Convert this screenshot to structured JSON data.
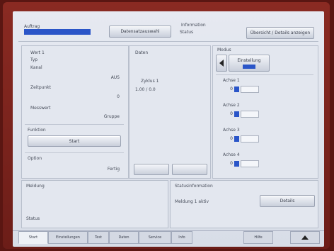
{
  "header": {
    "left_label": "Auftrag",
    "left_field_value": "",
    "main_button": "Datensatzauswahl",
    "right_label": "Information",
    "right_value": "Status",
    "right_button": "Übersicht / Details anzeigen"
  },
  "left_panel": {
    "rows": [
      {
        "label": "Wert 1",
        "value": ""
      },
      {
        "label": "Typ",
        "value": ""
      },
      {
        "label": "Kanal",
        "value": ""
      },
      {
        "label": "",
        "value": "AUS"
      },
      {
        "label": "Zeitpunkt",
        "value": ""
      },
      {
        "label": "",
        "value": "0"
      },
      {
        "label": "Messwert",
        "value": ""
      },
      {
        "label": "",
        "value": "Gruppe"
      }
    ],
    "section_label": "Funktion",
    "main_button": "Start",
    "bottom_label": "Option",
    "bottom_value": "Fertig"
  },
  "center_panel": {
    "title": "Daten",
    "line1": "Zyklus 1",
    "line2": "1.00 / 0.0",
    "btn_left": "",
    "btn_right": ""
  },
  "right_panel": {
    "top_label": "Modus",
    "top_sub_label": "Einstellung",
    "arrow_icon": "left-arrow-icon",
    "groups": [
      {
        "label": "Achse 1",
        "value": "0"
      },
      {
        "label": "Achse 2",
        "value": "0"
      },
      {
        "label": "Achse 3",
        "value": "0"
      },
      {
        "label": "Achse 4",
        "value": "0"
      }
    ]
  },
  "bottom_left": {
    "label1": "Meldung",
    "label2": "Status"
  },
  "bottom_right": {
    "title": "Statusinformation",
    "text": "Meldung 1 aktiv",
    "button": "Details"
  },
  "tabs": [
    {
      "label": "Start",
      "active": true
    },
    {
      "label": "Einstellungen",
      "active": false
    },
    {
      "label": "Test",
      "active": false
    },
    {
      "label": "Daten",
      "active": false
    },
    {
      "label": "Service",
      "active": false
    },
    {
      "label": "Info",
      "active": false
    },
    {
      "label": "Hilfe",
      "active": false
    },
    {
      "label": "",
      "active": false
    }
  ],
  "colors": {
    "accent": "#2a55c8",
    "bezel": "#7a221c",
    "screen_bg": "#e1e5ee"
  }
}
